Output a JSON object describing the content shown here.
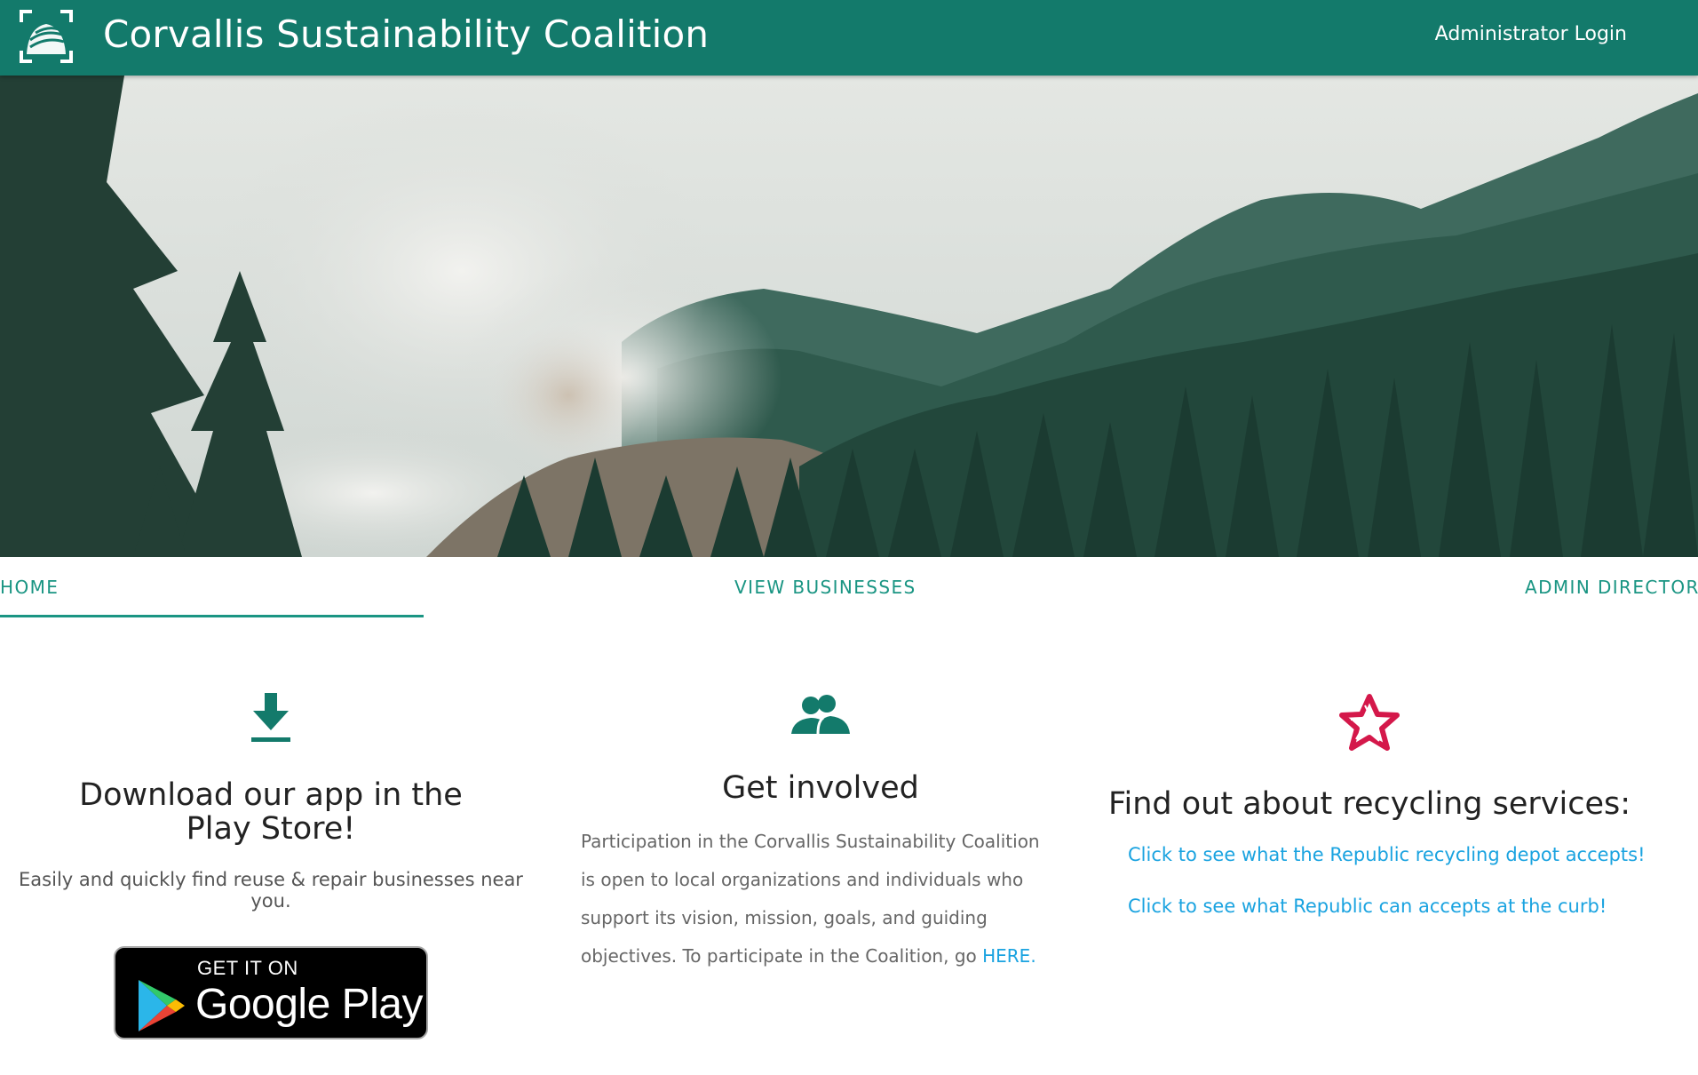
{
  "header": {
    "title": "Corvallis Sustainability Coalition",
    "admin_login": "Administrator Login",
    "logo_icon": "coalition-logo-icon"
  },
  "hero": {
    "description_icon": "forest-mountain-hero-image"
  },
  "tabs": [
    {
      "label": "HOME",
      "active": true
    },
    {
      "label": "VIEW BUSINESSES",
      "active": false
    },
    {
      "label": "ADMIN DIRECTORY",
      "active": false
    }
  ],
  "columns": {
    "download": {
      "icon": "download-icon",
      "heading": "Download our app in the Play Store!",
      "text": "Easily and quickly find reuse & repair businesses near you.",
      "badge_top": "GET IT ON",
      "badge_main": "Google Play"
    },
    "involved": {
      "icon": "people-icon",
      "heading": "Get involved",
      "text": "Participation in the Corvallis Sustainability Coalition is open to local organizations and individuals who support its vision, mission, goals, and guiding objectives. To participate in the Coalition, go ",
      "link": "HERE."
    },
    "recycling": {
      "icon": "recycling-star-icon",
      "heading": "Find out about recycling services:",
      "link_depot": "Click to see what the Republic recycling depot accepts!",
      "link_curb": "Click to see what Republic can accepts at the curb!"
    }
  },
  "colors": {
    "primary": "#137a6b",
    "tab_accent": "#1a9583",
    "link": "#1aa3e0",
    "recycle_icon": "#d4184a"
  }
}
